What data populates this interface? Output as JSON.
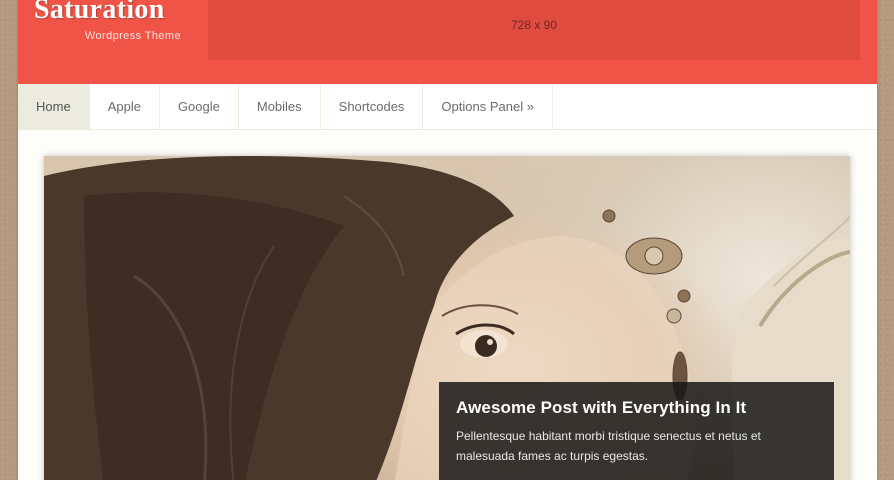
{
  "header": {
    "site_title": "Saturation",
    "tagline": "Wordpress Theme",
    "ad_placeholder": "728 x 90",
    "accent_color": "#ef5446"
  },
  "nav": {
    "items": [
      {
        "label": "Home",
        "active": true
      },
      {
        "label": "Apple"
      },
      {
        "label": "Google"
      },
      {
        "label": "Mobiles"
      },
      {
        "label": "Shortcodes"
      },
      {
        "label": "Options Panel »"
      }
    ]
  },
  "slider": {
    "caption_title": "Awesome Post with Everything In It",
    "caption_text": "Pellentesque habitant morbi tristique senectus et netus et malesuada fames ac turpis egestas."
  }
}
